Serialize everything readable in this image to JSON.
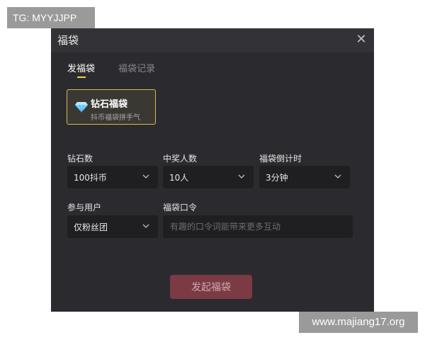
{
  "watermark": {
    "top": "TG: MYYJJPP",
    "bottom": "www.majiang17.org"
  },
  "dialog": {
    "title": "福袋",
    "close_icon": "close-icon",
    "tabs": [
      {
        "label": "发福袋",
        "active": true
      },
      {
        "label": "福袋记录",
        "active": false
      }
    ],
    "gift_option": {
      "icon": "diamond-icon",
      "title": "钻石福袋",
      "subtitle": "抖币福袋拼手气"
    },
    "fields": {
      "diamonds": {
        "label": "钻石数",
        "value": "100抖币"
      },
      "winners": {
        "label": "中奖人数",
        "value": "10人"
      },
      "countdown": {
        "label": "福袋倒计时",
        "value": "3分钟"
      },
      "participants": {
        "label": "参与用户",
        "value": "仅粉丝团"
      },
      "password": {
        "label": "福袋口令",
        "value": "",
        "placeholder": "有趣的口令词能带来更多互动"
      }
    },
    "submit_label": "发起福袋"
  },
  "colors": {
    "accent": "#f5d547",
    "card_border": "#d8b94a",
    "submit_bg": "#7c3a44",
    "dialog_bg": "#2b2b2f"
  }
}
